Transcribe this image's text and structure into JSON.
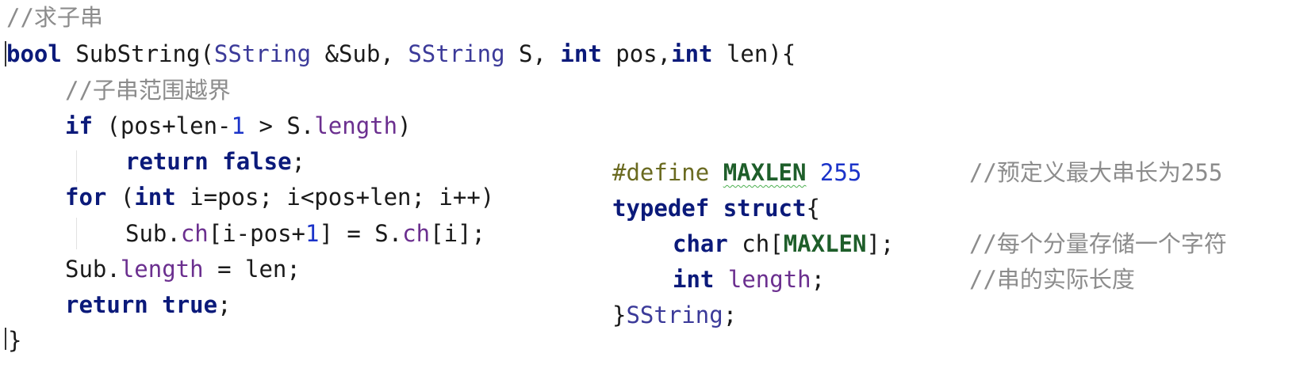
{
  "colors": {
    "keyword": "#0b1a7a",
    "type": "#3b3a99",
    "field": "#6b2f8f",
    "number": "#1b33c9",
    "comment": "#8c8c8c",
    "preprocessor": "#6a6a20",
    "macro": "#1e5e2a"
  },
  "left_code": {
    "l1_comment": "//求子串",
    "l2_bool": "bool",
    "l2_name": " SubString(",
    "l2_sstring1": "SString",
    "l2_sub": " &Sub, ",
    "l2_sstring2": "SString",
    "l2_s": " S, ",
    "l2_int1": "int",
    "l2_pos": " pos,",
    "l2_int2": "int",
    "l2_len": " len){",
    "l3_comment": "//子串范围越界",
    "l4_if": "if",
    "l4_a": " (pos+len-",
    "l4_one": "1",
    "l4_b": " > S.",
    "l4_length": "length",
    "l4_c": ")",
    "l5_return": "return",
    "l5_false": "false",
    "l5_semi": ";",
    "l6_for": "for",
    "l6_a": " (",
    "l6_int": "int",
    "l6_b": " i=pos; i<pos+len; i++)",
    "l7_a": "Sub.",
    "l7_ch1": "ch",
    "l7_b": "[i-pos+",
    "l7_one": "1",
    "l7_c": "] = S.",
    "l7_ch2": "ch",
    "l7_d": "[i];",
    "l8_a": "Sub.",
    "l8_length": "length",
    "l8_b": " = len;",
    "l9_return": "return",
    "l9_true": "true",
    "l9_semi": ";",
    "l10_brace": "}"
  },
  "right_code": {
    "r1_define": "#define",
    "r1_macro": "MAXLEN",
    "r1_num": "255",
    "r1_comment": "//预定义最大串长为255",
    "r2_typedef": "typedef",
    "r2_struct": "struct",
    "r2_brace": "{",
    "r3_char": "char",
    "r3_a": " ch[",
    "r3_macro": "MAXLEN",
    "r3_b": "];",
    "r3_comment": "//每个分量存储一个字符",
    "r4_int": "int",
    "r4_length": "length",
    "r4_semi": ";",
    "r4_comment": "//串的实际长度",
    "r5_brace": "}",
    "r5_sstring": "SString",
    "r5_semi": ";"
  }
}
